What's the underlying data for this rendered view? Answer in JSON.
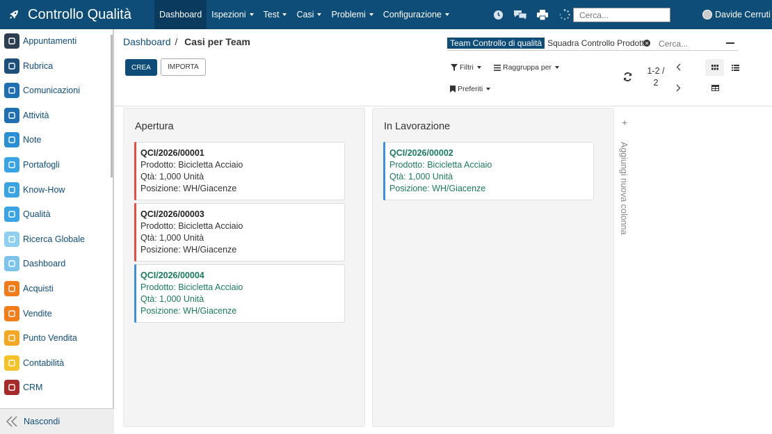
{
  "app": {
    "title": "Controllo Qualità",
    "brand_color": "#0f4d79"
  },
  "menu": [
    {
      "label": "Dashboard",
      "active": true,
      "has_caret": false
    },
    {
      "label": "Ispezioni",
      "has_caret": true
    },
    {
      "label": "Test",
      "has_caret": true
    },
    {
      "label": "Casi",
      "has_caret": true
    },
    {
      "label": "Problemi",
      "has_caret": true
    },
    {
      "label": "Configurazione",
      "has_caret": true
    }
  ],
  "topbar": {
    "icons": [
      "clock-icon",
      "chat-icon",
      "print-icon",
      "loading-spinner-icon"
    ],
    "search_placeholder": "Cerca...",
    "user_name": "Davide Cerruti"
  },
  "sidebar": {
    "items": [
      {
        "label": "Appuntamenti",
        "icon": "calendar-icon",
        "color": "#2c3e50"
      },
      {
        "label": "Rubrica",
        "icon": "contacts-icon",
        "color": "#1d4f7a"
      },
      {
        "label": "Comunicazioni",
        "icon": "message-icon",
        "color": "#1f6fb2"
      },
      {
        "label": "Attività",
        "icon": "checkbox-icon",
        "color": "#1f6fb2"
      },
      {
        "label": "Note",
        "icon": "note-icon",
        "color": "#2b8fd6"
      },
      {
        "label": "Portafogli",
        "icon": "lock-icon",
        "color": "#3aa3e3"
      },
      {
        "label": "Know-How",
        "icon": "brain-icon",
        "color": "#3aa3e3"
      },
      {
        "label": "Qualità",
        "icon": "quality-icon",
        "color": "#3aa3e3"
      },
      {
        "label": "Ricerca Globale",
        "icon": "search-icon",
        "color": "#8fd0f2"
      },
      {
        "label": "Dashboard",
        "icon": "dashboard-icon",
        "color": "#7cc4ec"
      },
      {
        "label": "Acquisti",
        "icon": "card-icon",
        "color": "#f07d1a"
      },
      {
        "label": "Vendite",
        "icon": "chart-line-icon",
        "color": "#f07d1a"
      },
      {
        "label": "Punto Vendita",
        "icon": "pos-icon",
        "color": "#f5a623"
      },
      {
        "label": "Contabilità",
        "icon": "accounting-icon",
        "color": "#f5c227"
      },
      {
        "label": "CRM",
        "icon": "handshake-icon",
        "color": "#a62b2b"
      }
    ],
    "footer_label": "Nascondi"
  },
  "breadcrumb": {
    "parent": "Dashboard",
    "separator": "/",
    "current": "Casi per Team"
  },
  "buttons": {
    "create": "CREA",
    "import": "IMPORTA"
  },
  "search": {
    "facet_label": "Team Controllo di qualità",
    "facet_value": "Squadra Controllo Prodotti",
    "placeholder": "Cerca..."
  },
  "filters": {
    "filters": "Filtri",
    "group_by": "Raggruppa per",
    "favorites": "Preferiti"
  },
  "pager": {
    "range": "1-2 /",
    "total": "2"
  },
  "kanban": {
    "columns": [
      {
        "title": "Apertura",
        "cards": [
          {
            "ref": "QCI/2026/00001",
            "product": "Prodotto: Bicicletta Acciaio",
            "qty": "Qtà: 1,000 Unità",
            "location": "Posizione: WH/Giacenze",
            "status_color": "#e74c3c"
          },
          {
            "ref": "QCI/2026/00003",
            "product": "Prodotto: Bicicletta Acciaio",
            "qty": "Qtà: 1,000 Unità",
            "location": "Posizione: WH/Giacenze",
            "status_color": "#e74c3c"
          },
          {
            "ref": "QCI/2026/00004",
            "product": "Prodotto: Bicicletta Acciaio",
            "qty": "Qtà: 1,000 Unità",
            "location": "Posizione: WH/Giacenze",
            "status_color": "#3b8fe0"
          }
        ]
      },
      {
        "title": "In Lavorazione",
        "cards": [
          {
            "ref": "QCI/2026/00002",
            "product": "Prodotto: Bicicletta Acciaio",
            "qty": "Qtà: 1,000 Unità",
            "location": "Posizione: WH/Giacenze",
            "status_color": "#3b8fe0"
          }
        ]
      }
    ],
    "add_column_label": "Aggiungi nuova colonna"
  }
}
